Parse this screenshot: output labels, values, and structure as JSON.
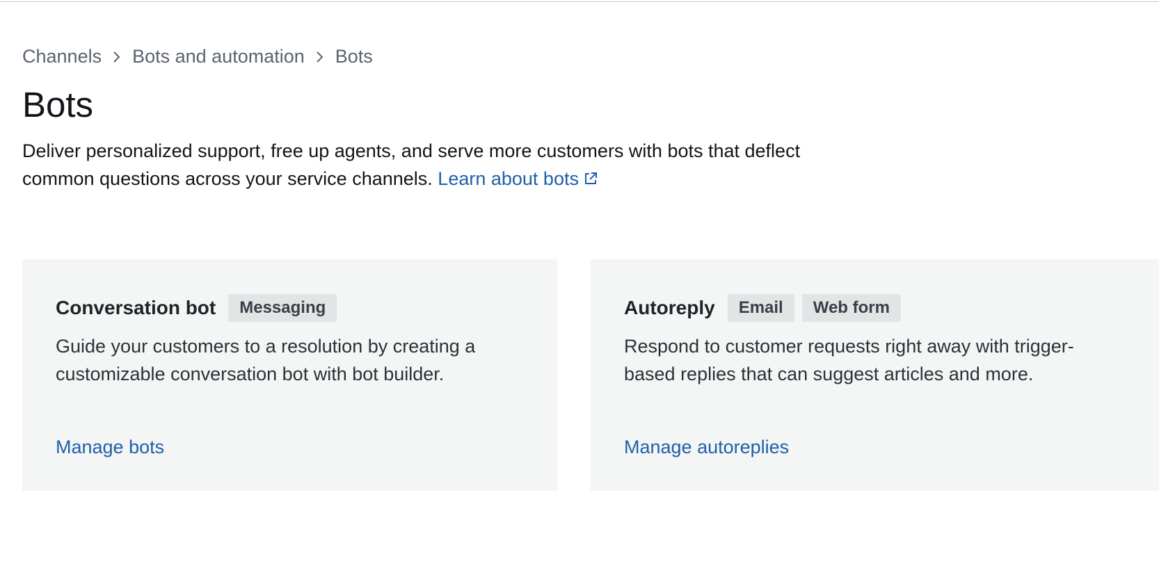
{
  "breadcrumb": {
    "items": [
      "Channels",
      "Bots and automation",
      "Bots"
    ]
  },
  "page": {
    "title": "Bots",
    "description": "Deliver personalized support, free up agents, and serve more customers with bots that deflect common questions across your service channels.",
    "learn_link": "Learn about bots"
  },
  "cards": [
    {
      "title": "Conversation bot",
      "tags": [
        "Messaging"
      ],
      "body": "Guide your customers to a resolution by creating a customizable conversation bot with bot builder.",
      "link": "Manage bots"
    },
    {
      "title": "Autoreply",
      "tags": [
        "Email",
        "Web form"
      ],
      "body": "Respond to customer requests right away with trigger-based replies that can suggest articles and more.",
      "link": "Manage autoreplies"
    }
  ],
  "colors": {
    "link": "#1f5fa8",
    "card_bg": "#f4f5f5",
    "tag_bg": "#e2e4e6"
  },
  "icons": {
    "breadcrumb_separator": "chevron-right-icon",
    "external_link": "external-link-icon"
  }
}
